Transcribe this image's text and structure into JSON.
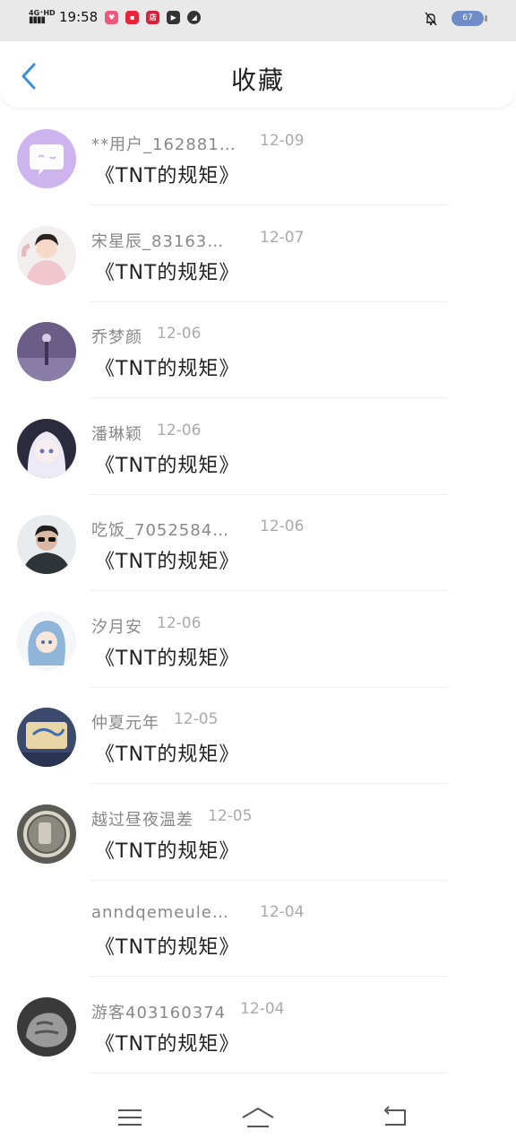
{
  "status_bar": {
    "network": "4G⁺HD",
    "time": "19:58",
    "apps": [
      {
        "icon": "app-pink-icon",
        "label": "",
        "color": "#f0577f"
      },
      {
        "icon": "app-red-icon",
        "label": "",
        "color": "#e8253b"
      },
      {
        "icon": "shop-icon",
        "label": "店",
        "color": "#d6213a"
      },
      {
        "icon": "play-icon",
        "label": "",
        "color": "#333333"
      },
      {
        "icon": "compass-icon",
        "label": "",
        "color": "#333333"
      }
    ],
    "battery": "67"
  },
  "header": {
    "title": "收藏",
    "back_icon": "chevron-left-icon",
    "accent": "#3a8fd8"
  },
  "items": [
    {
      "user": "**用户_162881…",
      "date": "12-09",
      "title": "《TNT的规矩》",
      "avatar": "chat-bubble"
    },
    {
      "user": "宋星辰_83163…",
      "date": "12-07",
      "title": "《TNT的规矩》",
      "avatar": "photo"
    },
    {
      "user": "乔梦颜",
      "date": "12-06",
      "title": "《TNT的规矩》",
      "avatar": "photo"
    },
    {
      "user": "潘琳颖",
      "date": "12-06",
      "title": "《TNT的规矩》",
      "avatar": "photo"
    },
    {
      "user": "吃饭_7052584…",
      "date": "12-06",
      "title": "《TNT的规矩》",
      "avatar": "photo"
    },
    {
      "user": "汐月安",
      "date": "12-06",
      "title": "《TNT的规矩》",
      "avatar": "photo"
    },
    {
      "user": "仲夏元年",
      "date": "12-05",
      "title": "《TNT的规矩》",
      "avatar": "photo"
    },
    {
      "user": "越过昼夜温差",
      "date": "12-05",
      "title": "《TNT的规矩》",
      "avatar": "photo"
    },
    {
      "user": "anndqemeulem…",
      "date": "12-04",
      "title": "《TNT的规矩》",
      "avatar": "none"
    },
    {
      "user": "游客403160374",
      "date": "12-04",
      "title": "《TNT的规矩》",
      "avatar": "photo"
    }
  ],
  "bottom_nav": {
    "menu_icon": "menu-icon",
    "home_icon": "home-icon",
    "back_icon": "return-icon"
  }
}
